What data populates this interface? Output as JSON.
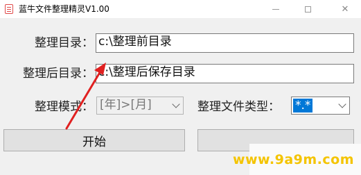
{
  "window": {
    "title": "蓝牛文件整理精灵V1.00",
    "minimize_glyph": "—",
    "maximize_glyph": "☐",
    "close_glyph": "✕"
  },
  "form": {
    "source_label": "整理目录：",
    "source_value": "c:\\整理前目录",
    "target_label": "整理后目录：",
    "target_value": "c:\\整理后保存目录",
    "mode_label": "整理模式：",
    "mode_value": "[年]>[月]",
    "filetype_label": "整理文件类型：",
    "filetype_value": "*.*"
  },
  "buttons": {
    "start": "开始",
    "second": ""
  },
  "watermark": {
    "text": "www.9a9m.com"
  },
  "colors": {
    "annotation_arrow": "#e02020",
    "selection": "#0078d7",
    "watermark": "#f4c400"
  }
}
